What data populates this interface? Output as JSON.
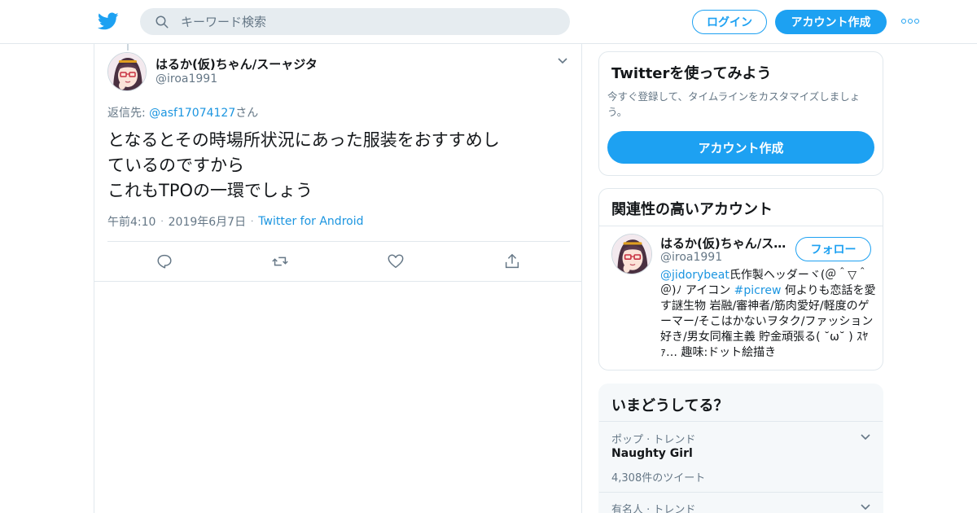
{
  "nav": {
    "search_placeholder": "キーワード検索",
    "login_label": "ログイン",
    "signup_label": "アカウント作成"
  },
  "tweet": {
    "display_name": "はるか(仮)ちゃん/スーャジタ",
    "screen_name": "@iroa1991",
    "reply_prefix": "返信先: ",
    "reply_mention": "@asf17074127",
    "reply_suffix": "さん",
    "text_lines": [
      "となるとその時場所状況にあった服装をおすすめし",
      "ているのですから",
      "これもTPOの一環でしょう"
    ],
    "time": "午前4:10",
    "date": "2019年6月7日",
    "source": "Twitter for Android"
  },
  "signup_card": {
    "title": "Twitterを使ってみよう",
    "description": "今すぐ登録して、タイムラインをカスタマイズしましょう。",
    "button_label": "アカウント作成"
  },
  "related_card": {
    "title": "関連性の高いアカウント",
    "name": "はるか(仮)ちゃん/ス…",
    "handle": "@iroa1991",
    "follow_label": "フォロー",
    "bio_link1": "@jidorybeat",
    "bio_part1": "氏作製ヘッダーヾ(＠＾▽＾＠)ﾉ アイコン ",
    "bio_link2": "#picrew",
    "bio_part2": " 何よりも恋話を愛す謎生物 岩融/審神者/筋肉愛好/軽度のゲーマー/そこはかないヲタク/ファッション好き/男女同権主義 貯金頑張る( ˘ω˘ ) ｽﾔｧ… 趣味:ドット絵描き"
  },
  "trends_card": {
    "title": "いまどうしてる？",
    "items": [
      {
        "meta": "ポップ · トレンド",
        "name": "Naughty Girl",
        "count": "4,308件のツイート"
      },
      {
        "meta": "有名人 · トレンド",
        "name": "",
        "count": ""
      }
    ]
  },
  "colors": {
    "accent": "#1da1f2",
    "link": "#1b95e0",
    "muted": "#657786",
    "border": "#e1e8ed"
  }
}
